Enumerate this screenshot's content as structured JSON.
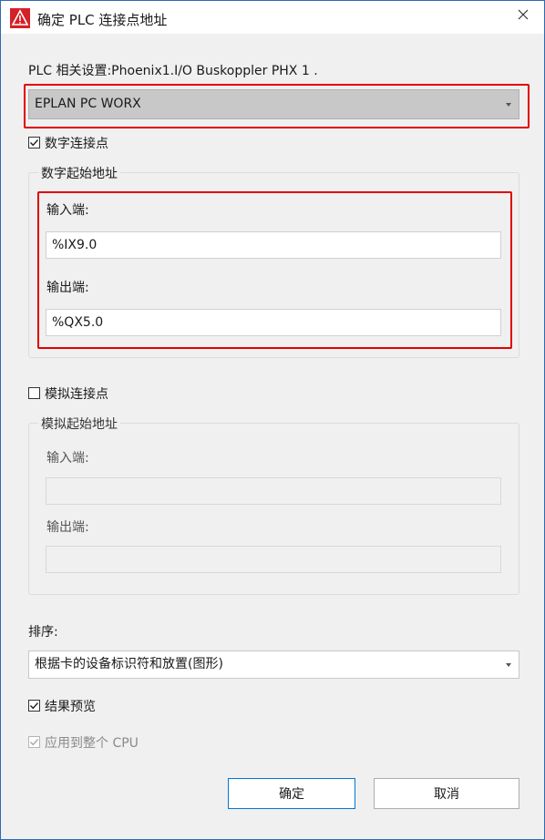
{
  "window": {
    "title": "确定 PLC 连接点地址",
    "close_glyph": "✕"
  },
  "plc_settings": {
    "label": "PLC 相关设置:Phoenix1.I/O Buskoppler PHX 1 .",
    "selected": "EPLAN PC WORX"
  },
  "digital": {
    "checkbox_label": "数字连接点",
    "checked": true,
    "group_title": "数字起始地址",
    "input_label": "输入端:",
    "input_value": "%IX9.0",
    "output_label": "输出端:",
    "output_value": "%QX5.0"
  },
  "analog": {
    "checkbox_label": "模拟连接点",
    "checked": false,
    "group_title": "模拟起始地址",
    "input_label": "输入端:",
    "input_value": "",
    "output_label": "输出端:",
    "output_value": ""
  },
  "sort": {
    "label": "排序:",
    "selected": "根据卡的设备标识符和放置(图形)"
  },
  "options": {
    "preview_label": "结果预览",
    "preview_checked": true,
    "apply_cpu_label": "应用到整个 CPU",
    "apply_cpu_checked": true,
    "apply_cpu_enabled": false
  },
  "buttons": {
    "ok": "确定",
    "cancel": "取消"
  },
  "colors": {
    "highlight": "#e00000",
    "accent": "#0078d7",
    "selected_bg": "#c8c8c8"
  }
}
